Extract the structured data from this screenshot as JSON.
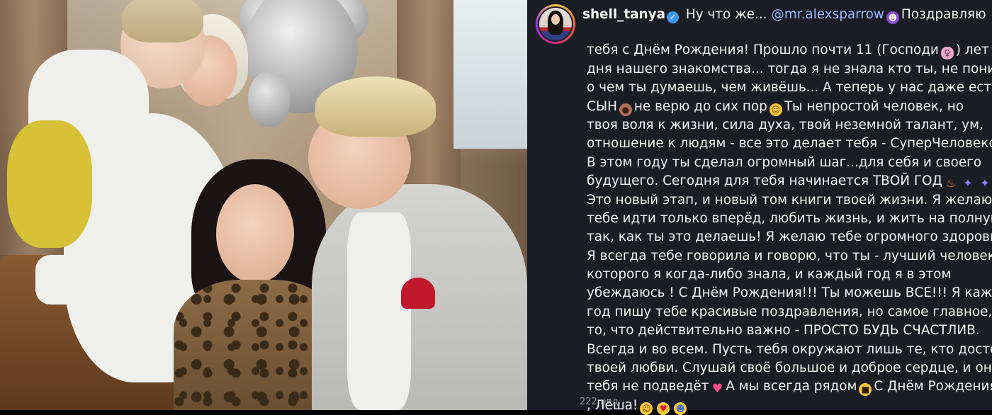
{
  "post": {
    "username": "shell_tanya",
    "verified_mark": "✓",
    "timestamp": "222 нед."
  },
  "caption": {
    "line1_text": "Ну что же...",
    "line1_mention": "@mr.alexsparrow",
    "line1_after": "Поздравляю",
    "line2_before": "тебя с Днём Рождения! Прошло почти 11 (Господи",
    "line2_after": ") лет со",
    "line3": "дня нашего знакомства... тогда я не знала кто ты, не понимала",
    "line4": "о чем ты думаешь, чем живёшь... А теперь у нас даже есть",
    "line5_before": "СЫН",
    "line5_middle": "не верю до сих пор",
    "line5_after": "Ты непростой человек, но",
    "line6": "твоя воля к жизни, сила духа, твой неземной талант, ум,",
    "line7": "отношение к людям - все это делает тебя - СуперЧеловеком.",
    "line8": "В этом году ты сделал огромный шаг...для себя и своего",
    "line9": "будущего. Сегодня для тебя начинается ТВОЙ ГОД",
    "line10": "Это новый этап, и новый том книги твоей жизни. Я желаю",
    "line11": "тебе идти только вперёд, любить жизнь, и жить на полную,",
    "line12": "так, как ты это делаешь! Я желаю тебе огромного здоровья!!!",
    "line13": "Я всегда тебе говорила и говорю, что ты - лучший человек,",
    "line14": "которого я когда-либо знала, и каждый год я в этом",
    "line15": "убеждаюсь ! С Днём Рождения!!! Ты можешь ВСЕ!!! Я каждый",
    "line16": "год пишу тебе красивые поздравления, но самое главное, и",
    "line17": "то, что действительно важно - ПРОСТО БУДЬ СЧАСТЛИВ.",
    "line18": "Всегда и во всем. Пусть тебя окружают лишь те, кто достоин",
    "line19": "твоей любви. Слушай своё большое и доброе сердце, и оно",
    "line20_before": "тебя не подведёт",
    "line20_middle": "А мы всегда рядом",
    "line20_after": "С Днём Рождения",
    "line21": ", Лёша!"
  },
  "emoji": {
    "devil": "devil-face-emoji",
    "facepalm": "woman-facepalming-emoji",
    "see_no_evil": "see-no-evil-monkey-emoji",
    "grin_hearts": "smiling-face-emoji",
    "fire": "fire-emoji",
    "party": "party-popper-emoji",
    "heart": "pink-heart-emoji",
    "cool": "smiling-face-with-sunglasses-emoji",
    "hug": "hugging-face-emoji",
    "heart_eyes": "heart-eyes-emoji",
    "party_face": "partying-face-emoji"
  },
  "colors": {
    "background": "#1b1d25",
    "text": "#f2f2f2",
    "mention": "#9bb8ff",
    "verified": "#3d97f0"
  }
}
